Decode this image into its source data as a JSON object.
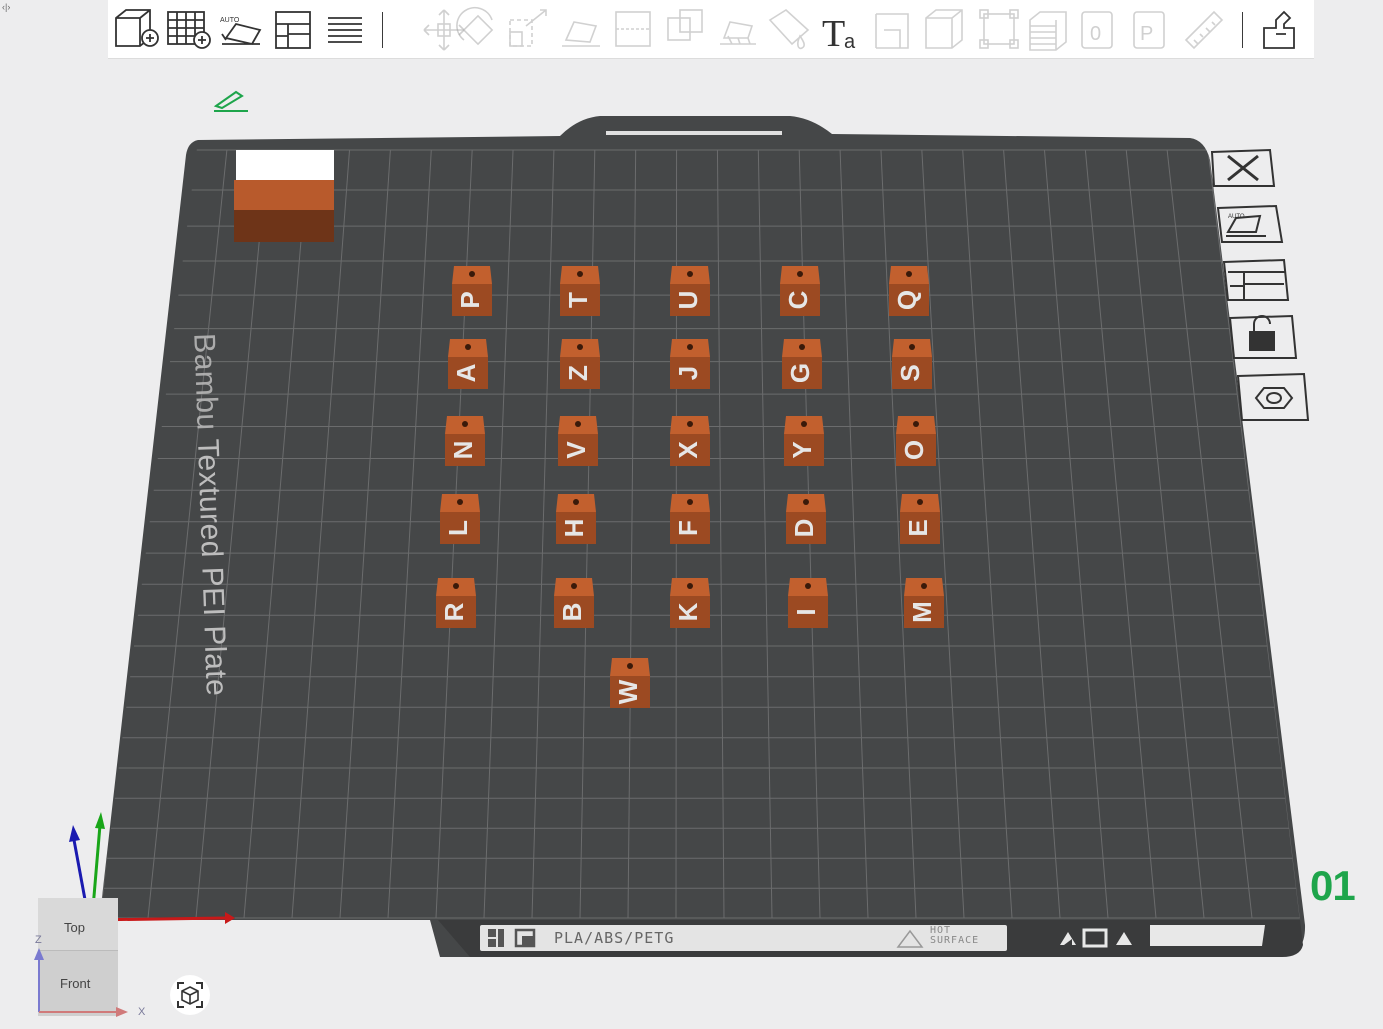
{
  "toolbar": {
    "tools": [
      {
        "name": "add-object-icon",
        "enabled": true
      },
      {
        "name": "add-plate-icon",
        "enabled": true
      },
      {
        "name": "auto-orient-icon",
        "enabled": true,
        "label": "AUTO"
      },
      {
        "name": "arrange-icon",
        "enabled": true
      },
      {
        "name": "layers-icon",
        "enabled": true
      },
      {
        "name": "move-icon",
        "enabled": false
      },
      {
        "name": "rotate-icon",
        "enabled": false
      },
      {
        "name": "scale-icon",
        "enabled": false
      },
      {
        "name": "lay-on-face-icon",
        "enabled": false
      },
      {
        "name": "cut-icon",
        "enabled": false
      },
      {
        "name": "boolean-icon",
        "enabled": false
      },
      {
        "name": "support-paint-icon",
        "enabled": false
      },
      {
        "name": "color-paint-icon",
        "enabled": false
      },
      {
        "name": "text-icon",
        "enabled": true
      },
      {
        "name": "seam-paint-icon",
        "enabled": false
      },
      {
        "name": "variable-layer-icon",
        "enabled": false
      },
      {
        "name": "fit-size-icon",
        "enabled": false
      },
      {
        "name": "slice-view-icon",
        "enabled": false
      },
      {
        "name": "assembly-icon",
        "enabled": false
      },
      {
        "name": "part-icon",
        "enabled": false
      },
      {
        "name": "measure-icon",
        "enabled": false
      },
      {
        "name": "explode-icon",
        "enabled": true
      }
    ],
    "auto_label": "AUTO"
  },
  "plate": {
    "name": "Textured PEI Plate",
    "name_prefix": "Bambu",
    "number": "01",
    "filament_label": "PLA/ABS/PETG",
    "hot_label_1": "HOT",
    "hot_label_2": "SURFACE"
  },
  "right_tools": [
    {
      "name": "close-plate-icon"
    },
    {
      "name": "auto-orient-plate-icon",
      "label": "AUTO"
    },
    {
      "name": "arrange-plate-icon"
    },
    {
      "name": "lock-plate-icon"
    },
    {
      "name": "plate-settings-icon"
    }
  ],
  "letter_blocks": [
    "P",
    "T",
    "U",
    "C",
    "Q",
    "A",
    "Z",
    "J",
    "G",
    "S",
    "N",
    "V",
    "X",
    "Y",
    "O",
    "L",
    "H",
    "F",
    "D",
    "E",
    "R",
    "B",
    "K",
    "I",
    "M",
    "W"
  ],
  "viewcube": {
    "top": "Top",
    "front": "Front"
  },
  "axes": {
    "x": "X",
    "z": "Z"
  },
  "colors": {
    "plate": "#454748",
    "grid": "#6b6c6d",
    "block_top": "#c2602e",
    "block_side": "#9c4a22",
    "plate_number": "#1ea54b",
    "edit_icon": "#1ea54b"
  }
}
